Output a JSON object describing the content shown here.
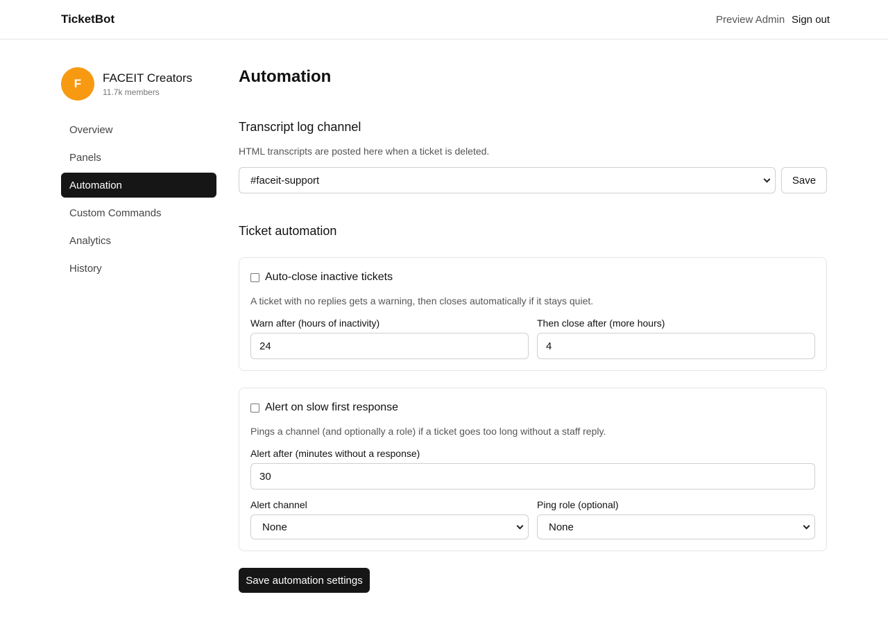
{
  "header": {
    "brand": "TicketBot",
    "preview_admin": "Preview Admin",
    "sign_out": "Sign out"
  },
  "server": {
    "initial": "F",
    "name": "FACEIT Creators",
    "members": "11.7k members",
    "avatar_color": "#f79a12"
  },
  "sidebar": {
    "items": [
      {
        "label": "Overview",
        "active": false
      },
      {
        "label": "Panels",
        "active": false
      },
      {
        "label": "Automation",
        "active": true
      },
      {
        "label": "Custom Commands",
        "active": false
      },
      {
        "label": "Analytics",
        "active": false
      },
      {
        "label": "History",
        "active": false
      }
    ]
  },
  "main": {
    "title": "Automation",
    "transcript": {
      "heading": "Transcript log channel",
      "description": "HTML transcripts are posted here when a ticket is deleted.",
      "selected_channel": "#faceit-support",
      "save_label": "Save"
    },
    "automation": {
      "heading": "Ticket automation",
      "auto_close": {
        "title": "Auto-close inactive tickets",
        "checked": false,
        "description": "A ticket with no replies gets a warning, then closes automatically if it stays quiet.",
        "warn_label": "Warn after (hours of inactivity)",
        "warn_value": "24",
        "close_label": "Then close after (more hours)",
        "close_value": "4"
      },
      "slow_response": {
        "title": "Alert on slow first response",
        "checked": false,
        "description": "Pings a channel (and optionally a role) if a ticket goes too long without a staff reply.",
        "alert_after_label": "Alert after (minutes without a response)",
        "alert_after_value": "30",
        "channel_label": "Alert channel",
        "channel_value": "None",
        "role_label": "Ping role (optional)",
        "role_value": "None"
      },
      "save_label": "Save automation settings"
    }
  },
  "colors": {
    "primary": "#161616",
    "accent": "#f79a12",
    "border": "#e5e5e5"
  }
}
